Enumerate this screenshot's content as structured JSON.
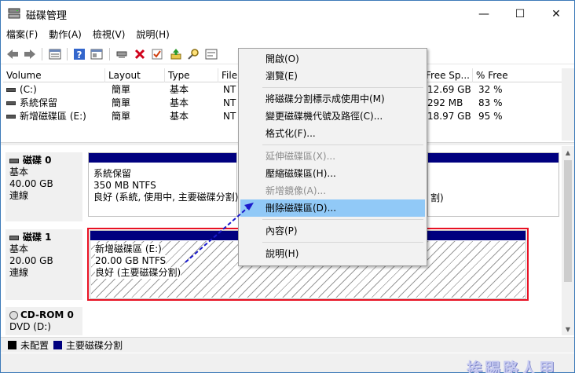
{
  "window": {
    "title": "磁碟管理",
    "minimize_glyph": "—",
    "maximize_glyph": "☐",
    "close_glyph": "✕"
  },
  "menu": [
    "檔案(F)",
    "動作(A)",
    "檢視(V)",
    "說明(H)"
  ],
  "toolbar": {
    "icons": [
      "back-icon",
      "forward-icon",
      "disk-list-icon",
      "help-icon",
      "properties-icon",
      "connect-icon",
      "delete-icon",
      "check-icon",
      "import-icon",
      "search-icon",
      "settings-icon"
    ]
  },
  "volume_list": {
    "columns": [
      "Volume",
      "Layout",
      "Type",
      "File",
      "Free Sp...",
      "% Free"
    ],
    "rows": [
      {
        "volume": "(C:)",
        "layout": "簡單",
        "type": "基本",
        "fs": "NT",
        "free": "12.69 GB",
        "pct": "32 %"
      },
      {
        "volume": "系統保留",
        "layout": "簡單",
        "type": "基本",
        "fs": "NT",
        "free": "292 MB",
        "pct": "83 %"
      },
      {
        "volume": "新增磁碟區 (E:)",
        "layout": "簡單",
        "type": "基本",
        "fs": "NT",
        "free": "18.97 GB",
        "pct": "95 %"
      }
    ]
  },
  "disks": [
    {
      "name": "磁碟 0",
      "type": "基本",
      "size": "40.00 GB",
      "status": "連線",
      "partition": {
        "name": "系統保留",
        "size": "350 MB NTFS",
        "status": "良好 (系統, 使用中, 主要磁碟分割)"
      },
      "partition2_status_tail": "割)"
    },
    {
      "name": "磁碟 1",
      "type": "基本",
      "size": "20.00 GB",
      "status": "連線",
      "partition": {
        "name": "新增磁碟區 (E:)",
        "size": "20.00 GB NTFS",
        "status": "良好 (主要磁碟分割)"
      }
    },
    {
      "name": "CD-ROM 0",
      "type": "DVD (D:)"
    }
  ],
  "legend": [
    {
      "label": "未配置",
      "color": "#000000"
    },
    {
      "label": "主要磁碟分割",
      "color": "#00007f"
    }
  ],
  "watermark": "挨踢路人甲",
  "context_menu": {
    "items": [
      {
        "label": "開啟(O)",
        "enabled": true
      },
      {
        "label": "瀏覽(E)",
        "enabled": true
      },
      {
        "label": "將磁碟分割標示成使用中(M)",
        "enabled": true
      },
      {
        "label": "變更磁碟機代號及路徑(C)...",
        "enabled": true
      },
      {
        "label": "格式化(F)...",
        "enabled": true
      },
      {
        "label": "延伸磁碟區(X)...",
        "enabled": false
      },
      {
        "label": "壓縮磁碟區(H)...",
        "enabled": true
      },
      {
        "label": "新增鏡像(A)...",
        "enabled": false
      },
      {
        "label": "刪除磁碟區(D)...",
        "enabled": true,
        "highlighted": true
      },
      {
        "label": "內容(P)",
        "enabled": true
      },
      {
        "label": "說明(H)",
        "enabled": true
      }
    ]
  },
  "colors": {
    "partition_bar": "#00007f",
    "highlight": "#91c9f7",
    "annotation_box": "#e81123",
    "annotation_arrow": "#1a1acc"
  }
}
